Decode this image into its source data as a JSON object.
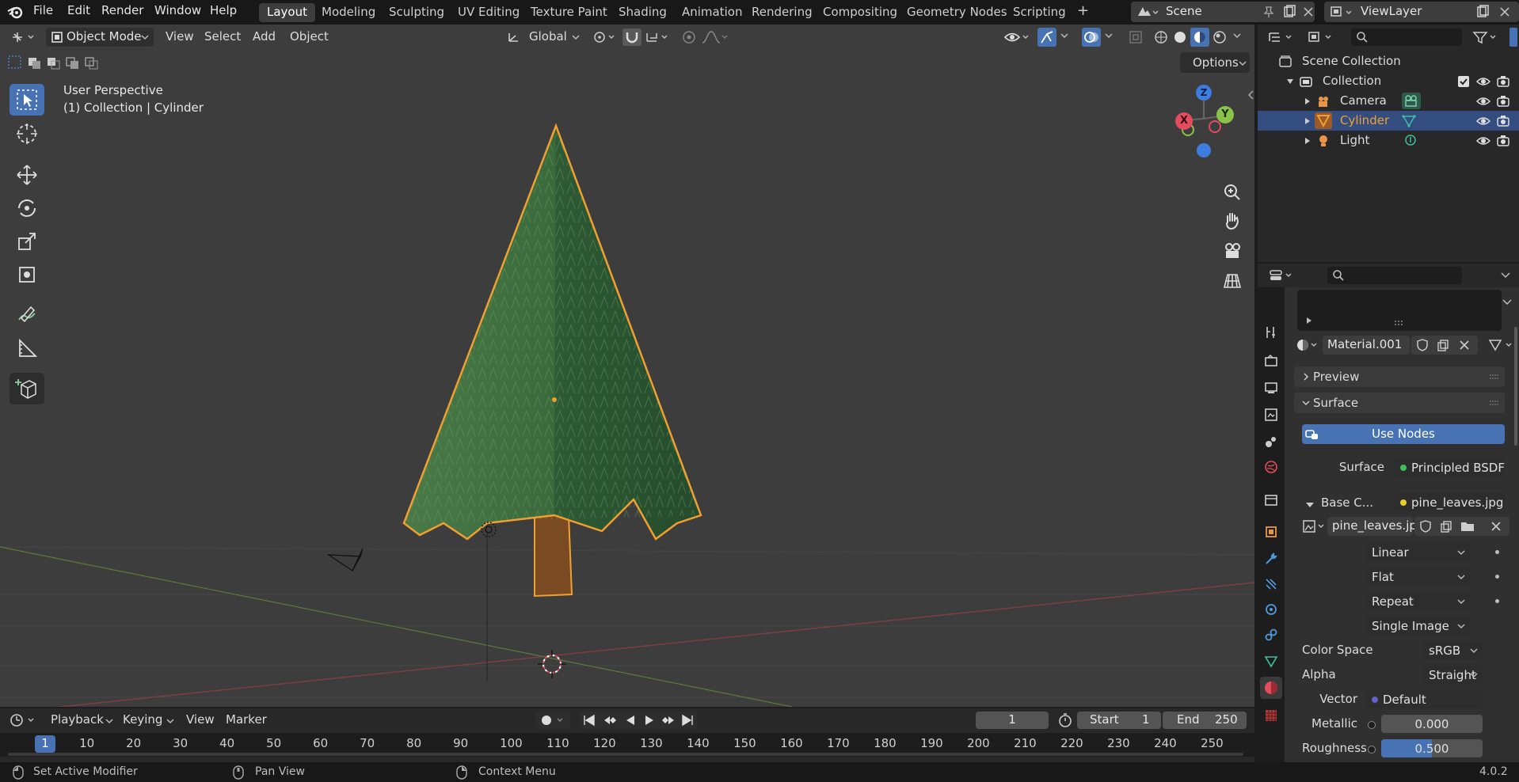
{
  "app_menu": [
    "File",
    "Edit",
    "Render",
    "Window",
    "Help"
  ],
  "workspaces": [
    "Layout",
    "Modeling",
    "Sculpting",
    "UV Editing",
    "Texture Paint",
    "Shading",
    "Animation",
    "Rendering",
    "Compositing",
    "Geometry Nodes",
    "Scripting"
  ],
  "active_workspace": "Layout",
  "add_workspace": "+",
  "scene": {
    "label": "Scene"
  },
  "view_layer": {
    "label": "ViewLayer"
  },
  "viewport_header": {
    "mode": "Object Mode",
    "menus": [
      "View",
      "Select",
      "Add",
      "Object"
    ],
    "orientation": "Global",
    "options": "Options"
  },
  "viewport": {
    "perspective": "User Perspective",
    "context": "(1) Collection | Cylinder",
    "gizmo": {
      "x": "X",
      "y": "Y",
      "z": "Z"
    }
  },
  "outliner": {
    "scene_collection": "Scene Collection",
    "collection": "Collection",
    "items": [
      {
        "name": "Camera",
        "selected": false
      },
      {
        "name": "Cylinder",
        "selected": true
      },
      {
        "name": "Light",
        "selected": false
      }
    ]
  },
  "properties": {
    "material_name": "Material.001",
    "panels": {
      "preview": "Preview",
      "surface": "Surface"
    },
    "use_nodes": "Use Nodes",
    "surface_label": "Surface",
    "surface_value": "Principled BSDF",
    "base_color_label": "Base C...",
    "base_color_value": "pine_leaves.jpg",
    "image_name": "pine_leaves.jpg",
    "interpolation": "Linear",
    "projection": "Flat",
    "extension": "Repeat",
    "source": "Single Image",
    "color_space_label": "Color Space",
    "color_space": "sRGB",
    "alpha_label": "Alpha",
    "alpha": "Straight",
    "vector_label": "Vector",
    "vector": "Default",
    "metallic_label": "Metallic",
    "metallic": "0.000",
    "roughness_label": "Roughness",
    "roughness": "0.500",
    "roughness_fraction": 0.5
  },
  "timeline": {
    "menus": [
      "Playback",
      "Keying",
      "View",
      "Marker"
    ],
    "current_frame": "1",
    "start_label": "Start",
    "start": "1",
    "end_label": "End",
    "end": "250",
    "ticks": [
      "1",
      "10",
      "20",
      "30",
      "40",
      "50",
      "60",
      "70",
      "80",
      "90",
      "100",
      "110",
      "120",
      "130",
      "140",
      "150",
      "160",
      "170",
      "180",
      "190",
      "200",
      "210",
      "220",
      "230",
      "240",
      "250"
    ]
  },
  "statusbar": {
    "left": "Set Active Modifier",
    "middle": "Pan View",
    "right": "Context Menu",
    "version": "4.0.2"
  },
  "colors": {
    "accent": "#4772b3",
    "selection_outline": "#f0a030",
    "axis_x": "#e24d5e",
    "axis_y": "#8bc34a",
    "axis_z": "#3d7de0"
  }
}
